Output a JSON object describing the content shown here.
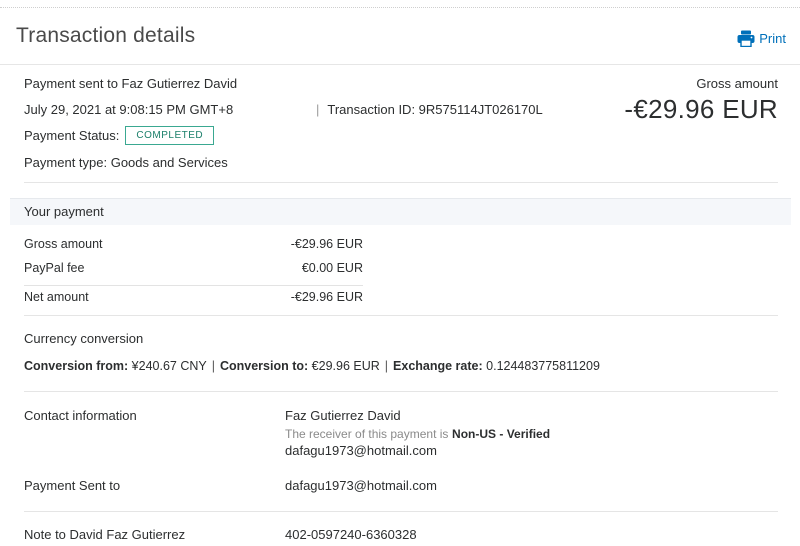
{
  "header": {
    "title": "Transaction details",
    "print_label": "Print"
  },
  "summary": {
    "payment_sent_to": "Payment sent to Faz Gutierrez David",
    "date": "July 29, 2021 at 9:08:15 PM GMT+8",
    "transaction_id": "Transaction ID: 9R575114JT026170L",
    "status_label": "Payment Status:",
    "status_value": "COMPLETED",
    "payment_type": "Payment type: Goods and Services",
    "gross_label": "Gross amount",
    "gross_value": "-€29.96 EUR"
  },
  "your_payment": {
    "title": "Your payment",
    "rows": [
      {
        "label": "Gross amount",
        "value": "-€29.96 EUR"
      },
      {
        "label": "PayPal fee",
        "value": "€0.00 EUR"
      },
      {
        "label": "Net amount",
        "value": "-€29.96 EUR"
      }
    ]
  },
  "currency_conversion": {
    "title": "Currency conversion",
    "from_label": "Conversion from:",
    "from_value": "¥240.67 CNY",
    "to_label": "Conversion to:",
    "to_value": "€29.96 EUR",
    "rate_label": "Exchange rate:",
    "rate_value": "0.124483775811209"
  },
  "contact": {
    "label": "Contact information",
    "name": "Faz Gutierrez David",
    "receiver_note": "The receiver of this payment is",
    "receiver_status": "Non-US - Verified",
    "email": "dafagu1973@hotmail.com"
  },
  "sent_to": {
    "label": "Payment Sent to",
    "value": "dafagu1973@hotmail.com"
  },
  "note": {
    "label": "Note to David Faz Gutierrez",
    "value": "402-0597240-6360328"
  },
  "colors": {
    "link": "#0070ba",
    "badge": "#3aa891",
    "band": "#f5f7fa"
  },
  "icons": {
    "print": "printer-icon"
  }
}
